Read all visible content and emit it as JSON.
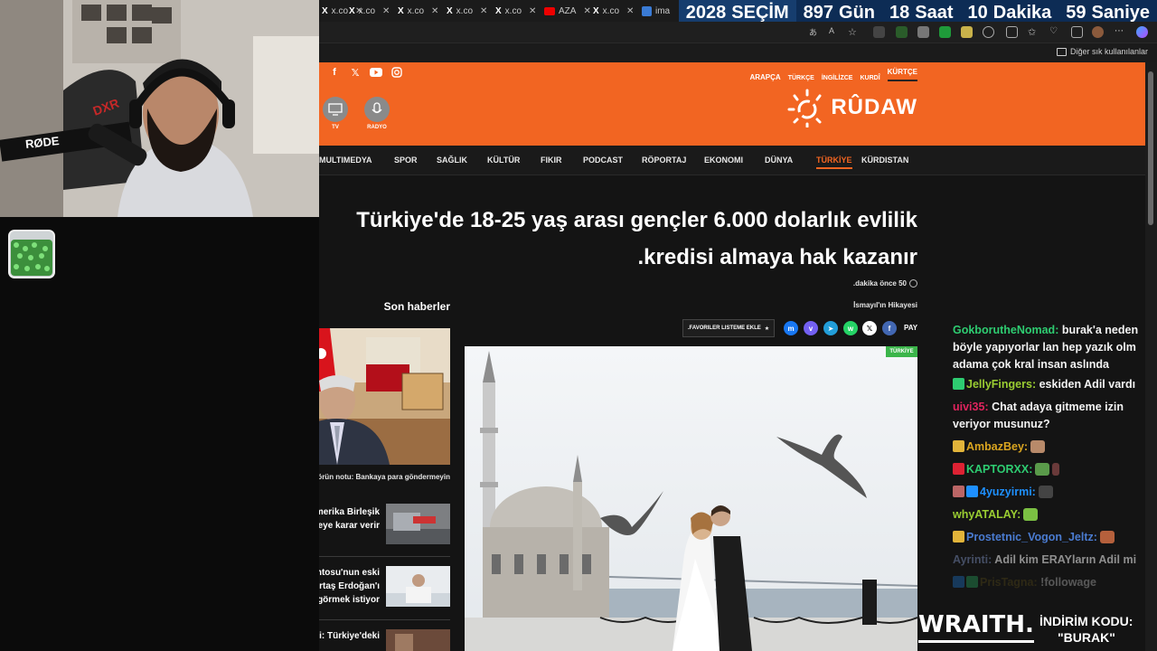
{
  "browser": {
    "tabs": [
      {
        "label": "x.co",
        "icon": "x-icon"
      },
      {
        "label": "x.co",
        "icon": "x-icon"
      },
      {
        "label": "x.co",
        "icon": "x-icon"
      },
      {
        "label": "x.co",
        "icon": "x-icon"
      },
      {
        "label": "x.co",
        "icon": "x-icon"
      },
      {
        "label": "x.co",
        "icon": "x-icon"
      },
      {
        "label": "AZA",
        "icon": "youtube-icon"
      },
      {
        "label": "x.co",
        "icon": "x-icon"
      },
      {
        "label": "ima",
        "icon": "image-icon"
      }
    ],
    "bookmarks_other": "Diğer sık kullanılanlar"
  },
  "countdown": {
    "year": "2028",
    "label": "SEÇİM",
    "days": "897",
    "days_unit": "Gün",
    "hours": "18",
    "hours_unit": "Saat",
    "minutes": "10",
    "minutes_unit": "Dakika",
    "seconds": "59",
    "seconds_unit": "Saniye"
  },
  "site": {
    "languages": [
      "ARAPÇA",
      "TÜRKÇE",
      "İNGİLİZCE",
      "KURDÎ",
      "KÜRTÇE"
    ],
    "media": {
      "tv": "TV",
      "radio": "RADYO"
    },
    "logo": "RÛDAW",
    "nav": [
      "MULTIMEDYA",
      "SPOR",
      "SAĞLIK",
      "KÜLTÜR",
      "FIKIR",
      "PODCAST",
      "RÖPORTAJ",
      "EKONOMI",
      "DÜNYA",
      "TÜRKİYE",
      "KÜRDISTAN"
    ],
    "nav_active_index": 9,
    "article": {
      "headline_line1": "Türkiye'de 18-25 yaş arası gençler 6.000 dolarlık evlilik",
      "headline_line2": ".kredisi almaya hak kazanır",
      "time": ".dakika önce 50",
      "author": "İsmayıl'ın Hikayesi",
      "favorites_button": ".FAVORILER LISTEME EKLE",
      "share_label": "PAY",
      "category_badge": "TÜRKİYE"
    },
    "sidebar": {
      "title": "Son haberler",
      "featured_caption": ".Editörün notu: Bankaya para göndermeyin",
      "items": [
        {
          "line1": "Oturur ve Amerika Birleşik",
          "line2": ".Devletleri'ne gitmeye karar verir"
        },
        {
          "line1": "Türk Parlamentosu'nun eski",
          "line2": "Başkanı: Demirtaş Erdoğan'ı",
          "line3": "görmek istiyor"
        },
        {
          "line1": "Savaş Esiri: Türkiye'deki",
          "line2": ""
        }
      ]
    }
  },
  "overlay": {
    "mic_brand": "RØDE",
    "chat": [
      {
        "user": "GokborutheNomad",
        "color": "#2ecc71",
        "text": " burak'a neden böyle yapıyorlar lan hep yazık olm adama çok kral insan aslında"
      },
      {
        "user": "JellyFingers",
        "color": "#9acd32",
        "text": " eskiden Adil vardı"
      },
      {
        "user": "uivi35",
        "color": "#e0245e",
        "text": " Chat adaya gitmeme izin veriyor musunuz?"
      },
      {
        "user": "AmbazBey",
        "color": "#daa520",
        "text": ""
      },
      {
        "user": "KAPTORXX",
        "color": "#2ecc71",
        "text": ""
      },
      {
        "user": "4yuzyirmi",
        "color": "#1e90ff",
        "text": ""
      },
      {
        "user": "whyATALAY",
        "color": "#9acd32",
        "text": ""
      },
      {
        "user": "Prostetnic_Vogon_Jeltz",
        "color": "#4a7bd0",
        "text": ""
      },
      {
        "user": "Ayrinti",
        "color": "#6d7fa8",
        "text": " Adil kim ERAYların Adil mi"
      },
      {
        "user": "PrisTagna",
        "color": "#6b5a1a",
        "text": " !followage"
      }
    ],
    "promo": {
      "brand": "WRAITH.",
      "code_label": "İNDİRİM KODU:",
      "code": "\"BURAK\""
    }
  },
  "colors": {
    "brand_orange": "#f26522",
    "countdown_bg": "#0d2c55",
    "badge_green": "#3bb54a"
  }
}
